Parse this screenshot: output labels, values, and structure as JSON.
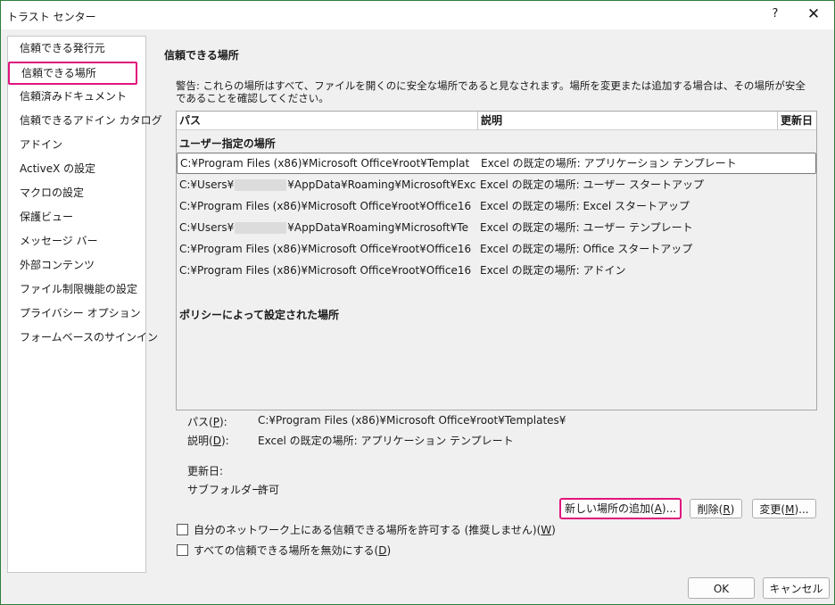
{
  "window": {
    "title": "トラスト センター",
    "help_label": "?",
    "close_label": "✕"
  },
  "sidebar": {
    "items": [
      "信頼できる発行元",
      "信頼できる場所",
      "信頼済みドキュメント",
      "信頼できるアドイン カタログ",
      "アドイン",
      "ActiveX の設定",
      "マクロの設定",
      "保護ビュー",
      "メッセージ バー",
      "外部コンテンツ",
      "ファイル制限機能の設定",
      "プライバシー オプション",
      "フォームベースのサインイン"
    ],
    "selected_index": 1
  },
  "main": {
    "section_title": "信頼できる場所",
    "warning": "警告: これらの場所はすべて、ファイルを開くのに安全な場所であると見なされます。場所を変更または追加する場合は、その場所が安全であることを確認してください。",
    "columns": {
      "path": "パス",
      "description": "説明",
      "modified": "更新日 ▾"
    },
    "user_group_label": "ユーザー指定の場所",
    "rows": [
      {
        "path_a": "C:¥Program Files (x86)¥Microsoft Office¥root¥Templat",
        "path_b": "",
        "description": "Excel の既定の場所: アプリケーション テンプレート"
      },
      {
        "path_a": "C:¥Users¥",
        "path_b": "¥AppData¥Roaming¥Microsoft¥Exc",
        "description": "Excel の既定の場所: ユーザー スタートアップ"
      },
      {
        "path_a": "C:¥Program Files (x86)¥Microsoft Office¥root¥Office16",
        "path_b": "",
        "description": "Excel の既定の場所: Excel スタートアップ"
      },
      {
        "path_a": "C:¥Users¥",
        "path_b": "¥AppData¥Roaming¥Microsoft¥Te",
        "description": "Excel の既定の場所: ユーザー テンプレート"
      },
      {
        "path_a": "C:¥Program Files (x86)¥Microsoft Office¥root¥Office16",
        "path_b": "",
        "description": "Excel の既定の場所: Office スタートアップ"
      },
      {
        "path_a": "C:¥Program Files (x86)¥Microsoft Office¥root¥Office16",
        "path_b": "",
        "description": "Excel の既定の場所: アドイン"
      }
    ],
    "policy_group_label": "ポリシーによって設定された場所"
  },
  "details": {
    "path_label": "パス(",
    "path_key": "P",
    "path_label_end": "):",
    "path_value": "C:¥Program Files (x86)¥Microsoft Office¥root¥Templates¥",
    "desc_label": "説明(",
    "desc_key": "D",
    "desc_label_end": "):",
    "desc_value": "Excel の既定の場所: アプリケーション テンプレート",
    "modified_label": "更新日:",
    "modified_value": "",
    "subfolders_label": "サブフォルダー:",
    "subfolders_value": "許可"
  },
  "buttons": {
    "add": {
      "pre": "新しい場所の追加(",
      "key": "A",
      "post": ")..."
    },
    "remove": {
      "pre": "削除(",
      "key": "R",
      "post": ")"
    },
    "modify": {
      "pre": "変更(",
      "key": "M",
      "post": ")..."
    },
    "ok": "OK",
    "cancel": "キャンセル"
  },
  "checkboxes": {
    "network": {
      "pre": "自分のネットワーク上にある信頼できる場所を許可する (推奨しません)(",
      "key": "W",
      "post": ")",
      "checked": false
    },
    "disable_all": {
      "pre": "すべての信頼できる場所を無効にする(",
      "key": "D",
      "post": ")",
      "checked": false
    }
  },
  "colors": {
    "highlight": "#e0147d",
    "window_border": "#2f7d3a"
  }
}
